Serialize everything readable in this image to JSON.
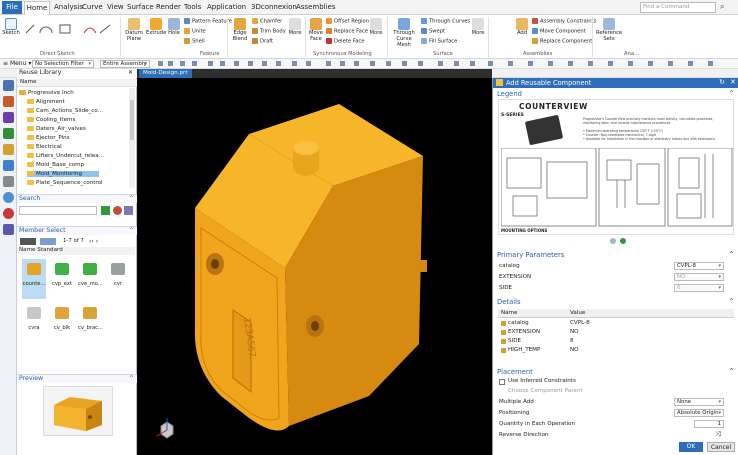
{
  "menu": {
    "file": "File",
    "items": [
      "Home",
      "Analysis",
      "Curve",
      "View",
      "Surface",
      "Render",
      "Tools",
      "Application",
      "3Dconnexion",
      "Assemblies"
    ],
    "search_placeholder": "Find a Command"
  },
  "ribbon": {
    "sketch": "Sketch",
    "direct_sketch": "Direct Sketch",
    "datum_plane": "Datum Plane",
    "extrude": "Extrude",
    "hole": "Hole",
    "pattern_feature": "Pattern Feature",
    "unite": "Unite",
    "shell": "Shell",
    "feature": "Feature",
    "more1": "More",
    "edge_blend": "Edge Blend",
    "chamfer": "Chamfer",
    "trim_body": "Trim Body",
    "draft": "Draft",
    "more2": "More",
    "move_face": "Move Face",
    "offset_region": "Offset Region",
    "replace_face": "Replace Face",
    "delete_face": "Delete Face",
    "more3": "More",
    "synchronous_modeling": "Synchronous Modeling",
    "through_curve_mesh": "Through Curve Mesh",
    "through_curves": "Through Curves",
    "swept": "Swept",
    "fill_surface": "Fill Surface",
    "more4": "More",
    "surface": "Surface",
    "add": "Add",
    "assembly_constraints": "Assembly Constraints",
    "move_component": "Move Component",
    "replace_component": "Replace Component",
    "assemblies": "Assemblies",
    "reference_sets": "Reference Sets",
    "more5": "More",
    "analysis": "Ana..."
  },
  "toolbar": {
    "menu": "Menu",
    "filter": "No Selection Filter",
    "assembly": "Entire Assembly"
  },
  "viewport_tab": "Mold-Design.prt",
  "reuse_library": {
    "title": "Reuse Library",
    "name_header": "Name",
    "tree": [
      "Progressive Inch",
      "Alignment",
      "Cam_Actions_Slide_co...",
      "Cooling_Items",
      "Daters_Air_valves",
      "Ejector_Pins",
      "Electrical",
      "Lifters_Undercut_relea...",
      "Mold_Base_comp",
      "Mold_Monitoring",
      "Plate_Sequence_control"
    ]
  },
  "search": {
    "title": "Search"
  },
  "member_select": {
    "title": "Member Select",
    "count": "1-7 of 7",
    "name_col": "Name",
    "standard_col": "Standard",
    "items": [
      {
        "label": "counte...",
        "color": "#e3a42a"
      },
      {
        "label": "cvp_ext",
        "color": "#3fb247"
      },
      {
        "label": "cve_mo...",
        "color": "#3db041"
      },
      {
        "label": "cvr",
        "color": "#9aa19c"
      },
      {
        "label": "cvra",
        "color": "#c7c7c7"
      },
      {
        "label": "cv_blk",
        "color": "#e0a43a"
      },
      {
        "label": "cv_brac...",
        "color": "#d6a43a"
      }
    ]
  },
  "preview": {
    "title": "Preview"
  },
  "dialog": {
    "title": "Add Reusable Component",
    "legend": "Legend",
    "legend_img": {
      "brand": "COUNTERVIEW",
      "series": "S-SERIES",
      "mounting": "MOUNTING OPTIONS",
      "desc": "Progressive's CounterView precisely monitors mold activity, calculates processes, monitoring data, and records maintenance procedures.",
      "spec1": "• Maximum operating temperature 250°F (120°C)",
      "spec2": "• Counter: Non-resettable mechanical, 7-digit",
      "spec3": "• Available for installation in the movable or stationary halves and with extensions"
    },
    "primary_params": "Primary Parameters",
    "params": [
      {
        "name": "catalog",
        "value": "CVPL-8",
        "enabled": true
      },
      {
        "name": "EXTENSION",
        "value": "NO",
        "enabled": false
      },
      {
        "name": "SIDE",
        "value": "6",
        "enabled": false
      }
    ],
    "details": "Details",
    "details_cols": [
      "Name",
      "Value"
    ],
    "details_rows": [
      {
        "name": "catalog",
        "value": "CVPL-8"
      },
      {
        "name": "EXTENSION",
        "value": "NO"
      },
      {
        "name": "SIDE",
        "value": "8"
      },
      {
        "name": "HIGH_TEMP",
        "value": "NO"
      }
    ],
    "placement": "Placement",
    "use_inferred": "Use Inferred Constraints",
    "choose_parent": "Choose Component Parent",
    "multiple_add": "Multiple Add",
    "multiple_add_value": "None",
    "positioning": "Positioning",
    "positioning_value": "Absolute Origin",
    "quantity": "Quantity in Each Operation",
    "quantity_value": "1",
    "reverse": "Reverse Direction",
    "ok": "OK",
    "cancel": "Cancel"
  },
  "part": {
    "label": "123A567",
    "colors": {
      "face_light": "#f7b62a",
      "face_front": "#f1a51c",
      "face_dark": "#c7800c",
      "side": "#d68a10"
    }
  }
}
